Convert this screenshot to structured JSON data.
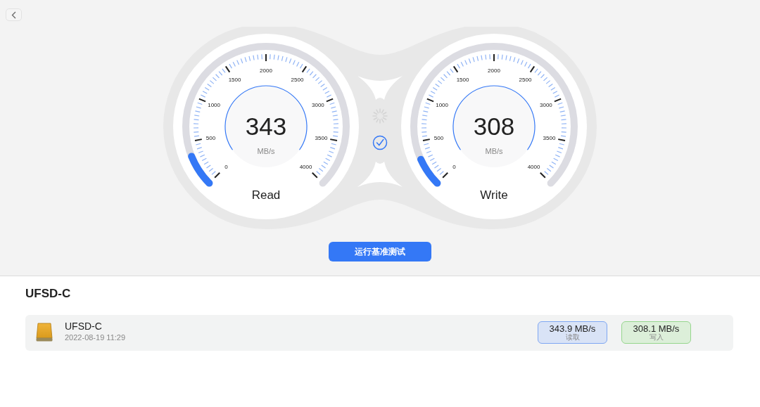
{
  "gauges": [
    {
      "label": "Read",
      "value": "343",
      "unit": "MB/s",
      "scale": [
        "0",
        "500",
        "1000",
        "1500",
        "2000",
        "2500",
        "3000",
        "3500",
        "4000"
      ]
    },
    {
      "label": "Write",
      "value": "308",
      "unit": "MB/s",
      "scale": [
        "0",
        "500",
        "1000",
        "1500",
        "2000",
        "2500",
        "3000",
        "3500",
        "4000"
      ]
    }
  ],
  "run_button": {
    "label": "运行基准测试"
  },
  "device_title": "UFSD-C",
  "results": [
    {
      "name": "UFSD-C",
      "date": "2022-08-19 11:29",
      "read": {
        "value": "343.9 MB/s",
        "label": "读取"
      },
      "write": {
        "value": "308.1 MB/s",
        "label": "写入"
      }
    }
  ]
}
